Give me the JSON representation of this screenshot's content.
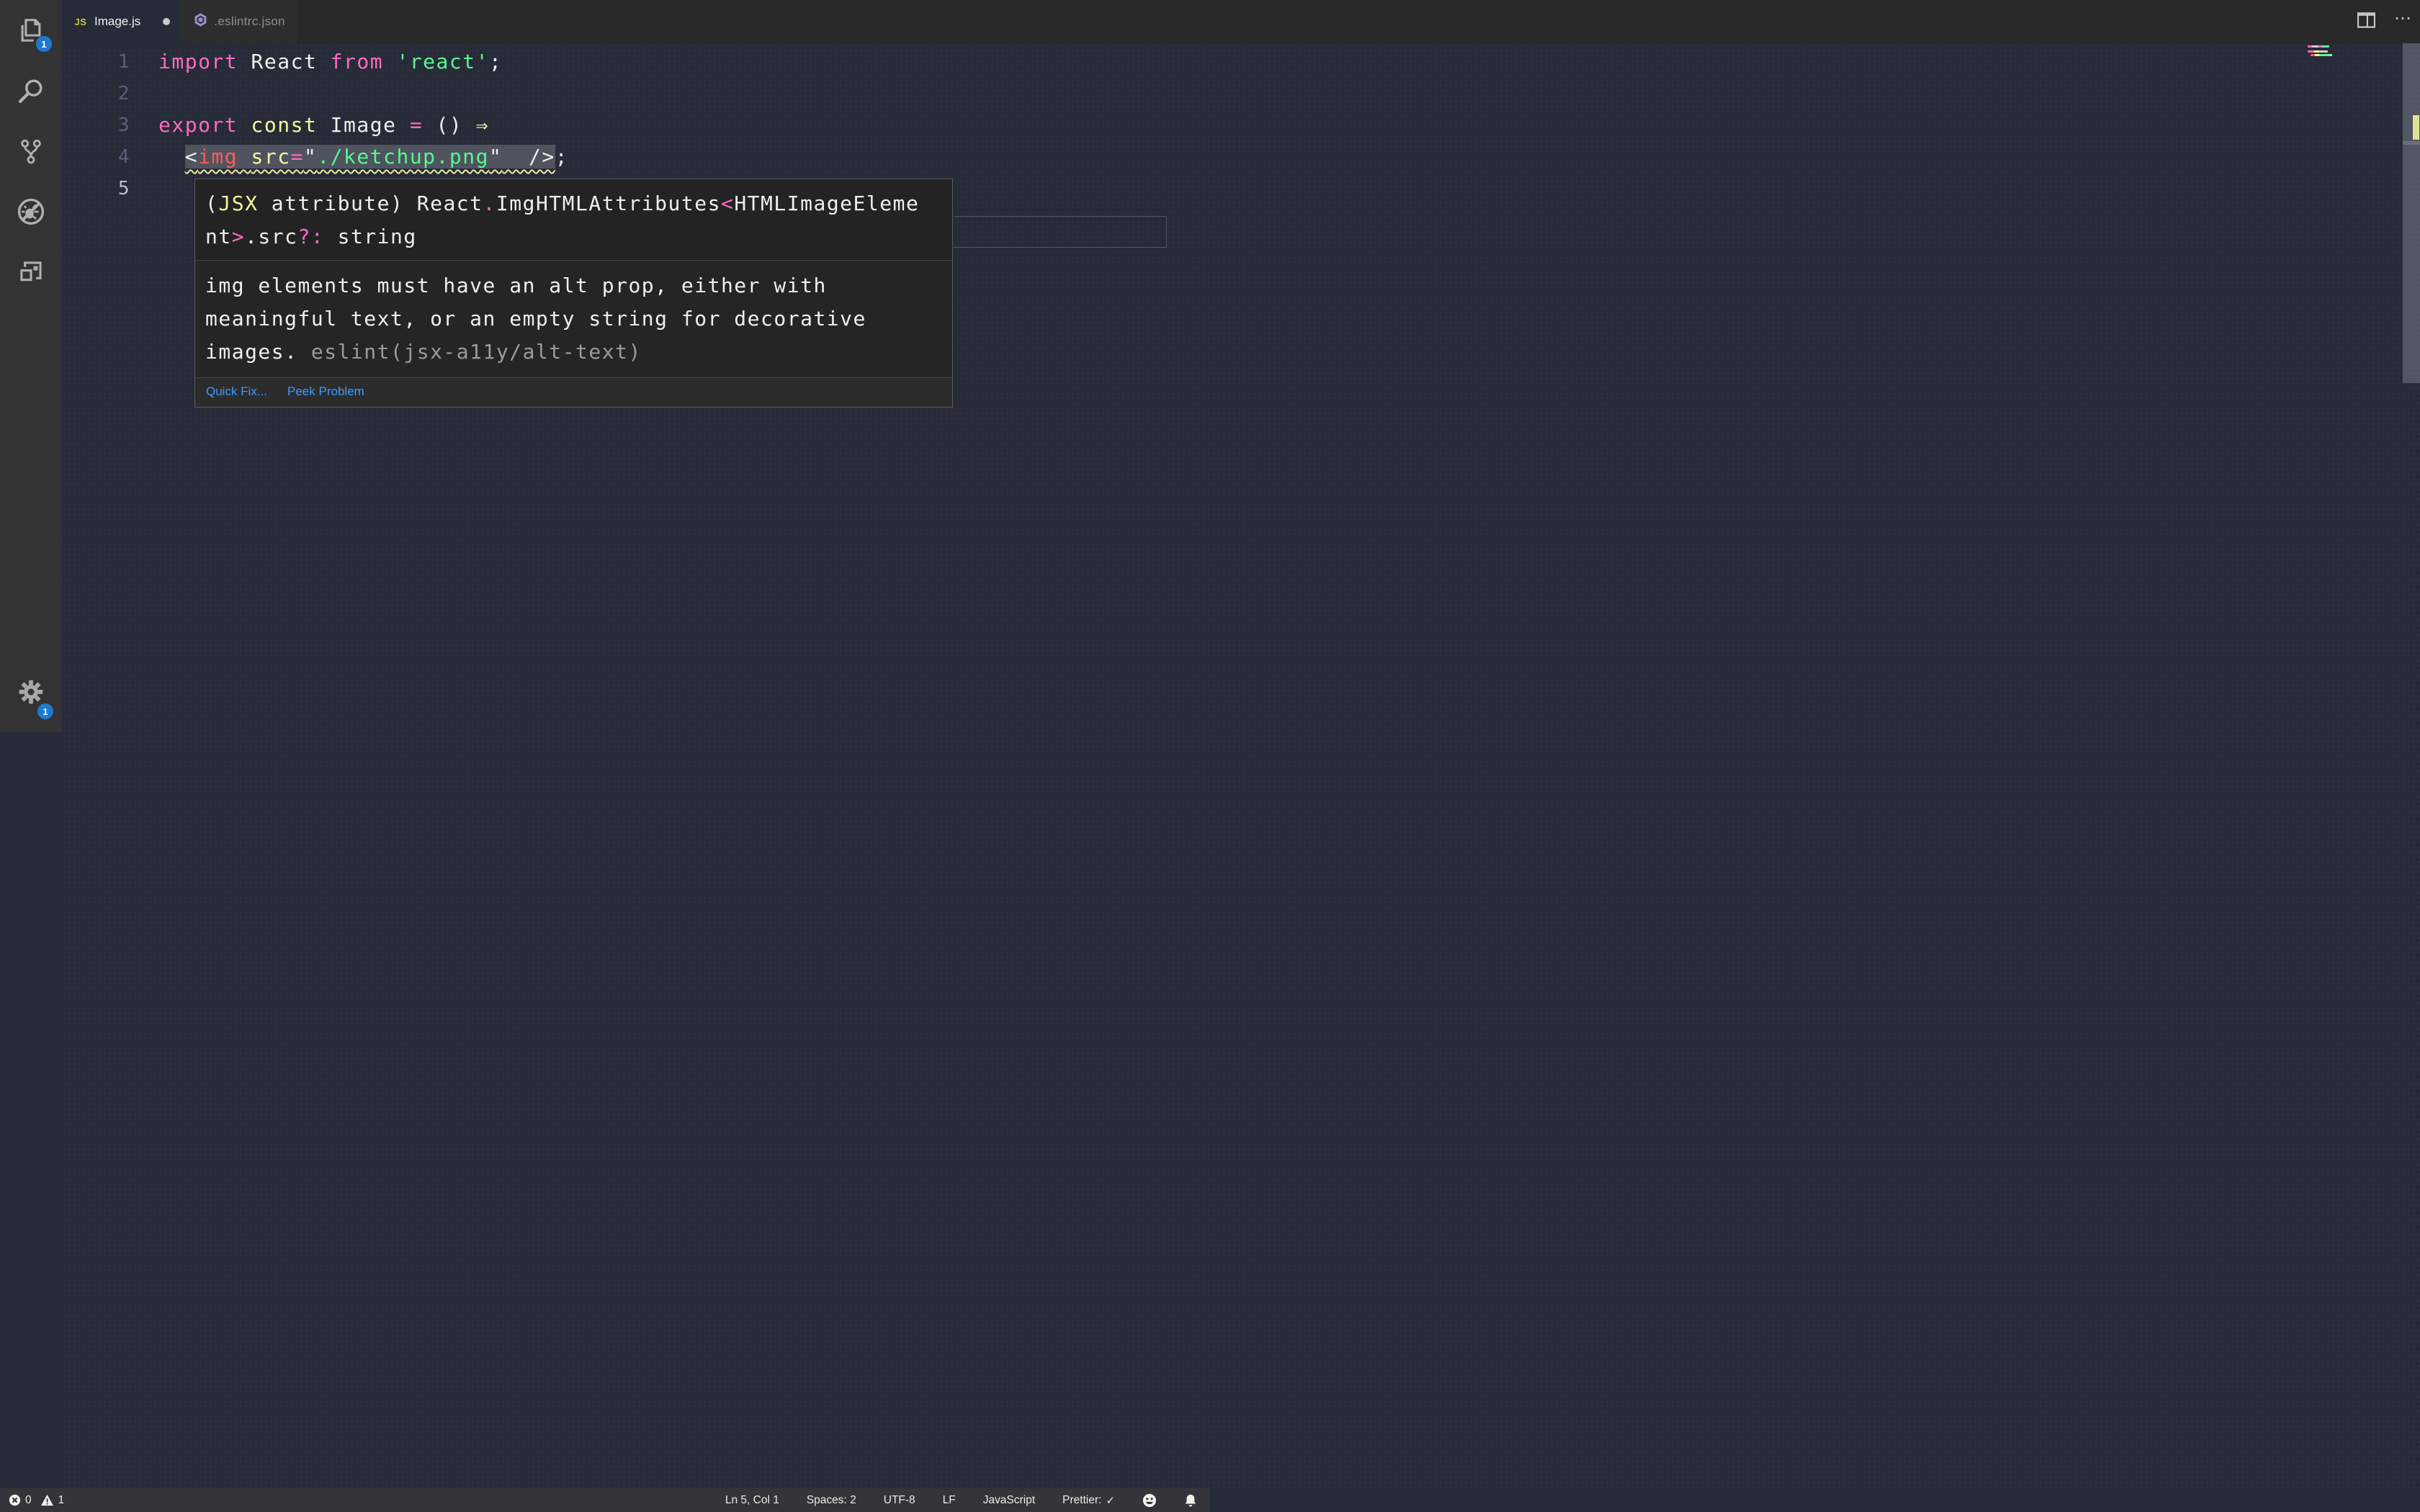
{
  "colors": {
    "editor_bg": "#272b38",
    "chrome_bg": "#333333",
    "accent_badge": "#1e7ad1",
    "keyword_pink": "#ff6ac1",
    "const_yellow": "#f3f99d",
    "string_green": "#5af78e",
    "tag_red": "#ff5c57",
    "fg_white": "#eff0eb",
    "link_blue": "#3e9bff",
    "squiggle_yellow": "#e9eb9e"
  },
  "activity_bar": {
    "explorer_badge": "1",
    "settings_badge": "1"
  },
  "tabs": [
    {
      "label": "Image.js",
      "icon": "js",
      "js_glyph": "JS",
      "modified": true,
      "active": true
    },
    {
      "label": ".eslintrc.json",
      "icon": "eslint",
      "active": false
    }
  ],
  "editor_actions": {
    "more_label": "⋯"
  },
  "editor": {
    "lines": [
      {
        "num": "1",
        "tokens": [
          {
            "t": "import",
            "c": "pink"
          },
          {
            "t": " React ",
            "c": "white"
          },
          {
            "t": "from",
            "c": "pink"
          },
          {
            "t": " ",
            "c": "white"
          },
          {
            "t": "'react'",
            "c": "green"
          },
          {
            "t": ";",
            "c": "white"
          }
        ]
      },
      {
        "num": "2",
        "tokens": []
      },
      {
        "num": "3",
        "tokens": [
          {
            "t": "export",
            "c": "pink"
          },
          {
            "t": " ",
            "c": "white"
          },
          {
            "t": "const",
            "c": "yellow"
          },
          {
            "t": " Image ",
            "c": "white"
          },
          {
            "t": "=",
            "c": "pink"
          },
          {
            "t": " () ",
            "c": "white"
          },
          {
            "t": "⇒",
            "c": "yellow"
          }
        ]
      },
      {
        "num": "4",
        "indent": "  ",
        "selection_tokens": [
          {
            "t": "<",
            "c": "white"
          },
          {
            "t": "img",
            "c": "red"
          },
          {
            "t": " ",
            "c": "white"
          },
          {
            "t": "src",
            "c": "yellow"
          },
          {
            "t": "=",
            "c": "pink"
          },
          {
            "t": "\"",
            "c": "white"
          },
          {
            "t": "./ketchup.png",
            "c": "green"
          },
          {
            "t": "\"",
            "c": "white"
          },
          {
            "t": "  />",
            "c": "white"
          }
        ],
        "after_tokens": [
          {
            "t": ";",
            "c": "white"
          }
        ]
      },
      {
        "num": "5",
        "tokens": [],
        "current": true
      }
    ]
  },
  "hover": {
    "signature_lines": [
      [
        {
          "t": "(",
          "c": "white"
        },
        {
          "t": "JSX",
          "c": "yellow"
        },
        {
          "t": " attribute) React",
          "c": "white"
        },
        {
          "t": ".",
          "c": "pink"
        },
        {
          "t": "ImgHTMLAttributes",
          "c": "white"
        },
        {
          "t": "<",
          "c": "pink"
        },
        {
          "t": "HTMLImageEleme",
          "c": "white"
        }
      ],
      [
        {
          "t": "nt",
          "c": "white"
        },
        {
          "t": ">",
          "c": "pink"
        },
        {
          "t": ".src",
          "c": "white"
        },
        {
          "t": "?:",
          "c": "pink"
        },
        {
          "t": " string",
          "c": "white"
        }
      ]
    ],
    "message_lines": [
      [
        {
          "t": "img elements must have an alt prop, either with",
          "c": "white"
        }
      ],
      [
        {
          "t": "meaningful text, or an empty string for decorative",
          "c": "white"
        }
      ],
      [
        {
          "t": "images. ",
          "c": "white"
        },
        {
          "t": "eslint(jsx-a11y/alt-text)",
          "c": "gray"
        }
      ]
    ],
    "actions": {
      "quick_fix": "Quick Fix...",
      "peek_problem": "Peek Problem"
    }
  },
  "status_bar": {
    "errors": "0",
    "warnings": "1",
    "cursor_position": "Ln 5, Col 1",
    "indentation": "Spaces: 2",
    "encoding": "UTF-8",
    "eol": "LF",
    "language": "JavaScript",
    "formatter": "Prettier:",
    "formatter_check": "✓"
  }
}
